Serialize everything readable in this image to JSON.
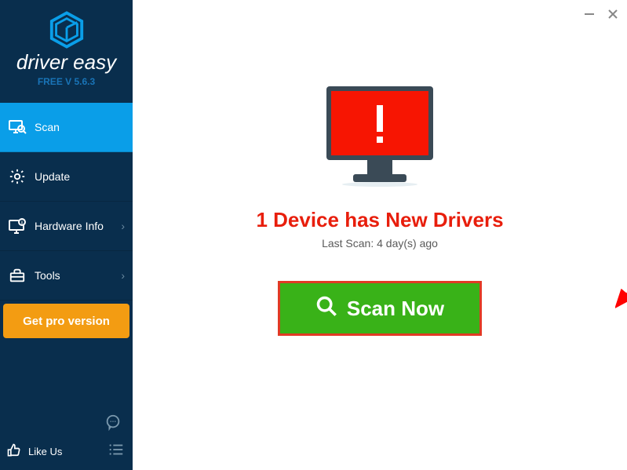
{
  "brand": "driver easy",
  "version": "FREE V 5.6.3",
  "sidebar": {
    "items": [
      {
        "label": "Scan"
      },
      {
        "label": "Update"
      },
      {
        "label": "Hardware Info"
      },
      {
        "label": "Tools"
      }
    ],
    "pro_label": "Get pro version",
    "like_label": "Like Us"
  },
  "main": {
    "headline": "1 Device has New Drivers",
    "last_scan": "Last Scan: 4 day(s) ago",
    "scan_button": "Scan Now"
  },
  "annotation": {
    "arrow_color": "#ff0000"
  }
}
